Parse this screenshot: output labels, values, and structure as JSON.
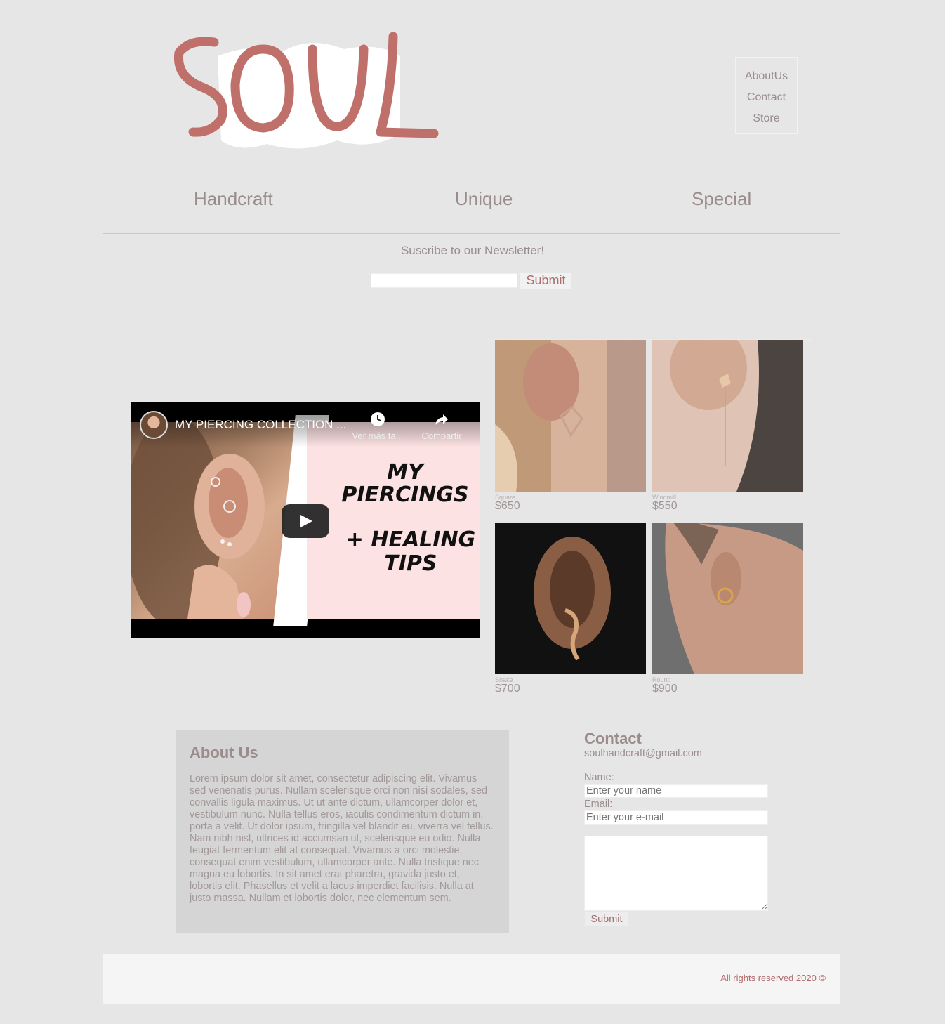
{
  "brand": {
    "logo_text": "SOUL",
    "logo_color": "#c0706b"
  },
  "top_nav": {
    "items": [
      {
        "label": "AboutUs"
      },
      {
        "label": "Contact"
      },
      {
        "label": "Store"
      }
    ]
  },
  "taglines": [
    "Handcraft",
    "Unique",
    "Special"
  ],
  "newsletter": {
    "title": "Suscribe to our Newsletter!",
    "input_value": "",
    "submit_label": "Submit"
  },
  "video": {
    "title": "MY PIERCING COLLECTION ...",
    "watch_later_label": "Ver más ta...",
    "share_label": "Compartir",
    "overlay_line1": "MY",
    "overlay_line2": "PIERCINGS",
    "overlay_line3": "+ HEALING",
    "overlay_line4": "TIPS",
    "play_icon": "play-icon"
  },
  "products": [
    {
      "name": "Square",
      "price": "$650"
    },
    {
      "name": "Windmill",
      "price": "$550"
    },
    {
      "name": "Snake",
      "price": "$700"
    },
    {
      "name": "Round",
      "price": "$900"
    }
  ],
  "about": {
    "title": "About Us",
    "text": "Lorem ipsum dolor sit amet, consectetur adipiscing elit. Vivamus sed venenatis purus. Nullam scelerisque orci non nisi sodales, sed convallis ligula maximus. Ut ut ante dictum, ullamcorper dolor et, vestibulum nunc. Nulla tellus eros, iaculis condimentum dictum in, porta a velit. Ut dolor ipsum, fringilla vel blandit eu, viverra vel tellus. Nam nibh nisl, ultrices id accumsan ut, scelerisque eu odio. Nulla feugiat fermentum elit at consequat. Vivamus a orci molestie, consequat enim vestibulum, ullamcorper ante. Nulla tristique nec magna eu lobortis. In sit amet erat pharetra, gravida justo et, lobortis elit. Phasellus et velit a lacus imperdiet facilisis. Nulla at justo massa. Nullam et lobortis dolor, nec elementum sem."
  },
  "contact": {
    "title": "Contact",
    "email": "soulhandcraft@gmail.com",
    "name_label": "Name:",
    "name_placeholder": "Enter your name",
    "email_label": "Email:",
    "email_placeholder": "Enter your e-mail",
    "message_value": "",
    "submit_label": "Submit"
  },
  "footer": {
    "text": "All rights reserved 2020 ©"
  }
}
